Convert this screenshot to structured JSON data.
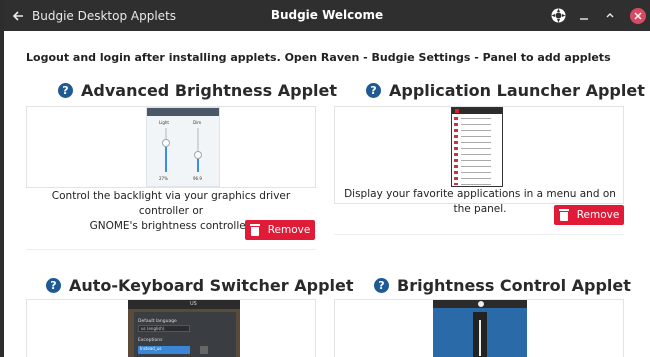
{
  "window": {
    "section_label": "Budgie Desktop Applets",
    "title": "Budgie Welcome"
  },
  "notice": "Logout and login after installing applets. Open Raven - Budgie Settings - Panel to add applets",
  "applets": [
    {
      "title": "Advanced Brightness Applet",
      "description_line1": "Control the backlight via your graphics driver controller or",
      "description_line2": "GNOME's brightness controller.",
      "button": "Remove",
      "shot_labels": {
        "left": "Light",
        "right": "Dim",
        "bottom_left": "27%",
        "bottom_right": "96.9"
      }
    },
    {
      "title": "Application Launcher Applet",
      "description": "Display your favorite applications in a menu and on the panel.",
      "button": "Remove"
    },
    {
      "title": "Auto-Keyboard Switcher Applet",
      "shot_labels": {
        "header": "US",
        "default_language": "Default language",
        "language_value": "us (english)",
        "exceptions": "Exceptions",
        "exception_value": "Instead_us"
      }
    },
    {
      "title": "Brightness Control Applet"
    }
  ],
  "colors": {
    "titlebar": "#2f2f2f",
    "remove": "#e01b38",
    "help_icon": "#1f5a94"
  },
  "icons": [
    "back-arrow-icon",
    "budgie-logo-icon",
    "minimize-icon",
    "maximize-icon",
    "close-icon",
    "help-icon",
    "trash-icon"
  ]
}
